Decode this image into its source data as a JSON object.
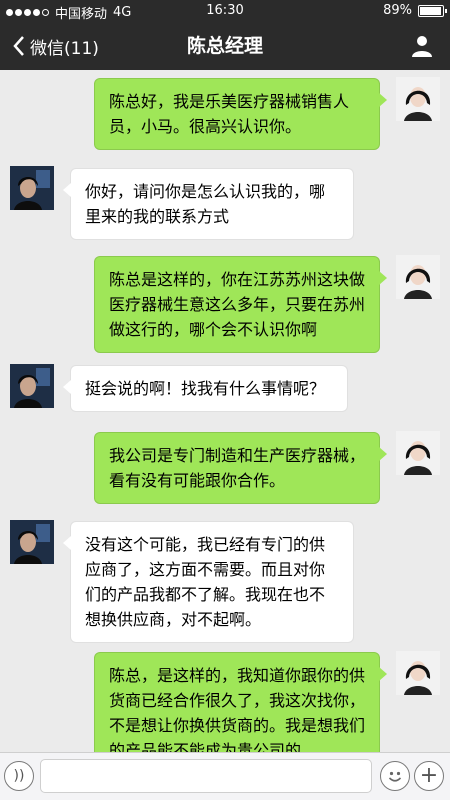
{
  "status_bar": {
    "carrier": "中国移动",
    "network": "4G",
    "time": "16:30",
    "battery": "89%",
    "battery_level": 0.89
  },
  "nav": {
    "back_label": "微信(11)",
    "title": "陈总经理",
    "back_icon": "chevron-left-icon",
    "profile_icon": "person-icon"
  },
  "messages": [
    {
      "from": "me",
      "text": "陈总好，我是乐美医疗器械销售人员，小马。很高兴认识你。"
    },
    {
      "from": "other",
      "text": "你好，请问你是怎么认识我的，哪里来的我的联系方式"
    },
    {
      "from": "me",
      "text": "陈总是这样的，你在江苏苏州这块做医疗器械生意这么多年，只要在苏州做这行的，哪个会不认识你啊"
    },
    {
      "from": "other",
      "text": "挺会说的啊！找我有什么事情呢？"
    },
    {
      "from": "me",
      "text": "我公司是专门制造和生产医疗器械，看有没有可能跟你合作。"
    },
    {
      "from": "other",
      "text": "没有这个可能，我已经有专门的供应商了，这方面不需要。而且对你们的产品我都不了解。我现在也不想换供应商，对不起啊。"
    },
    {
      "from": "me",
      "text": "陈总，是这样的，我知道你跟你的供货商已经合作很久了，我这次找你，不是想让你换供货商的。我是想我们的产品能不能成为贵公司的"
    }
  ],
  "input_bar": {
    "voice_icon": "voice-icon",
    "emoji_icon": "emoji-icon",
    "plus_icon": "plus-icon",
    "plus_glyph": "+",
    "voice_glyph": "))",
    "text_value": ""
  },
  "colors": {
    "bar_bg": "#2b2b2b",
    "chat_bg": "#ebebeb",
    "my_bubble": "#9fe658",
    "other_bubble": "#ffffff"
  }
}
